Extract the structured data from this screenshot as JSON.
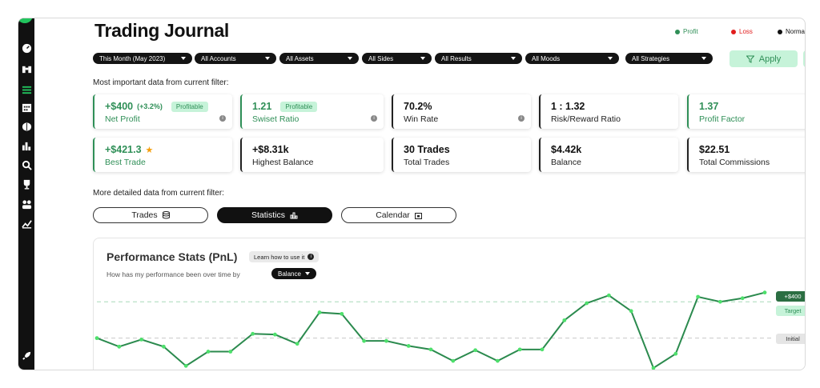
{
  "app": {
    "title": "Trading Journal"
  },
  "legend": [
    {
      "label": "Profit",
      "color": "#2f8f57"
    },
    {
      "label": "Loss",
      "color": "#e11d1d"
    },
    {
      "label": "Normal",
      "color": "#111111"
    }
  ],
  "filters": [
    {
      "label": "This Month (May 2023)"
    },
    {
      "label": "All Accounts"
    },
    {
      "label": "All Assets"
    },
    {
      "label": "All Sides"
    },
    {
      "label": "All Results"
    },
    {
      "label": "All Moods"
    },
    {
      "label": "All Strategies"
    }
  ],
  "apply_label": "Apply",
  "section1": "Most important data from current filter:",
  "section2": "More detailed data from current filter:",
  "stats": [
    {
      "value": "+$400",
      "sub": "(+3.2%)",
      "badge": "Profitable",
      "label": "Net Profit",
      "green": true,
      "info": true
    },
    {
      "value": "1.21",
      "sub": "",
      "badge": "Profitable",
      "label": "Swiset Ratio",
      "green": true,
      "info": true
    },
    {
      "value": "70.2%",
      "sub": "",
      "badge": "",
      "label": "Win Rate",
      "green": false,
      "info": true
    },
    {
      "value": "1 : 1.32",
      "sub": "",
      "badge": "",
      "label": "Risk/Reward Ratio",
      "green": false,
      "info": false
    },
    {
      "value": "1.37",
      "sub": "",
      "badge": "",
      "label": "Profit Factor",
      "green": true,
      "info": false
    },
    {
      "value": "+$421.3",
      "sub": "",
      "badge": "",
      "label": "Best Trade",
      "green": true,
      "info": false,
      "star": true
    },
    {
      "value": "+$8.31k",
      "sub": "",
      "badge": "",
      "label": "Highest Balance",
      "green": false,
      "info": false
    },
    {
      "value": "30 Trades",
      "sub": "",
      "badge": "",
      "label": "Total Trades",
      "green": false,
      "info": false
    },
    {
      "value": "$4.42k",
      "sub": "",
      "badge": "",
      "label": "Balance",
      "green": false,
      "info": false
    },
    {
      "value": "$22.51",
      "sub": "",
      "badge": "",
      "label": "Total Commissions",
      "green": false,
      "info": false
    }
  ],
  "tabs": [
    {
      "label": "Trades",
      "icon": "database-icon",
      "active": false
    },
    {
      "label": "Statistics",
      "icon": "bar-chart-icon",
      "active": true
    },
    {
      "label": "Calendar",
      "icon": "calendar-icon",
      "active": false
    }
  ],
  "panel": {
    "title": "Performance Stats (PnL)",
    "learn": "Learn how to use it",
    "question": "How has my performance been over time by",
    "dropdown": "Balance"
  },
  "chart_data": {
    "type": "line",
    "series": [
      {
        "values": [
          0.42,
          0.3,
          0.4,
          0.3,
          0.03,
          0.23,
          0.23,
          0.48,
          0.47,
          0.34,
          0.78,
          0.76,
          0.38,
          0.38,
          0.31,
          0.26,
          0.1,
          0.25,
          0.1,
          0.26,
          0.26,
          0.67,
          0.91,
          1.02,
          0.8,
          0.0,
          0.2,
          1.0,
          0.93,
          0.98,
          1.06
        ]
      }
    ],
    "reference_lines": [
      {
        "label": "Target",
        "value": 0.93
      },
      {
        "label": "Initial",
        "value": 0.42
      }
    ],
    "end_label": "+$400",
    "colors": {
      "line": "#2b8a4e",
      "point": "#4ee06c"
    }
  }
}
